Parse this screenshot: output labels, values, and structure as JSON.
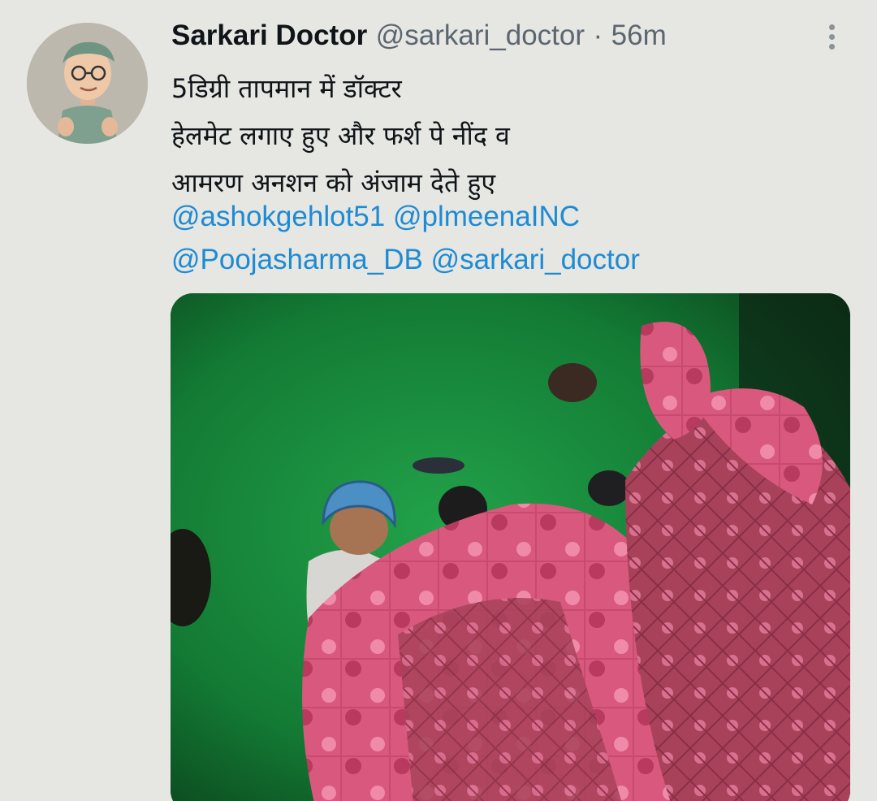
{
  "tweet": {
    "author_name": "Sarkari Doctor",
    "author_handle": "@sarkari_doctor",
    "separator": "·",
    "time": "56m",
    "text_lines": [
      "5डिग्री तापमान में डॉक्टर",
      "हेलमेट लगाए हुए और फर्श पे नींद व",
      "आमरण अनशन को अंजाम देते हुए"
    ],
    "mentions": [
      "@ashokgehlot51",
      "@plmeenaINC",
      "@Poojasharma_DB",
      "@sarkari_doctor"
    ]
  },
  "icons": {
    "more": "more-vertical-icon"
  },
  "colors": {
    "background": "#e6e6e2",
    "text": "#0f1419",
    "muted": "#5b6670",
    "link": "#1d8bd3"
  }
}
